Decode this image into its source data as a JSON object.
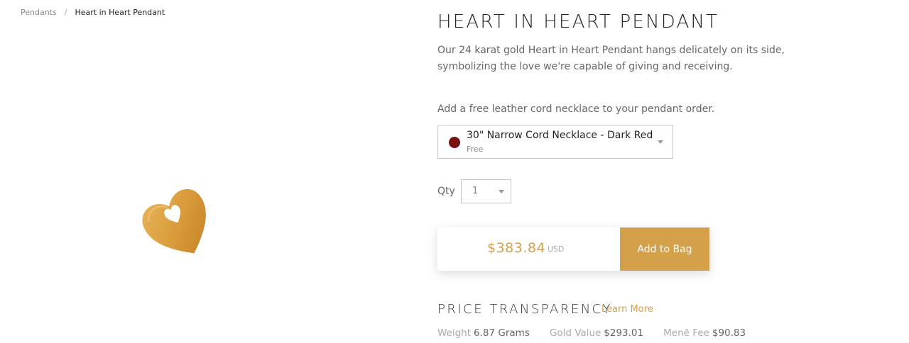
{
  "breadcrumb": {
    "parent": "Pendants",
    "separator": "/",
    "current": "Heart in Heart Pendant"
  },
  "product": {
    "title": "HEART IN HEART PENDANT",
    "description": "Our 24 karat gold Heart in Heart Pendant hangs delicately on its side, symbolizing the love we're capable of giving and receiving.",
    "image_icon": "gold-heart-pendant-icon"
  },
  "cord": {
    "prompt": "Add a free leather cord necklace to your pendant order.",
    "selected_label": "30\" Narrow Cord Necklace - Dark Red",
    "selected_sub": "Free",
    "swatch_color": "#7a1010"
  },
  "qty": {
    "label": "Qty",
    "value": "1"
  },
  "purchase": {
    "price": "$383.84",
    "currency": "USD",
    "button_label": "Add to Bag",
    "accent_color": "#d4a04a"
  },
  "transparency": {
    "title": "PRICE TRANSPARENCY",
    "learn_more": "Learn More",
    "metrics": [
      {
        "key": "Weight",
        "value": "6.87 Grams"
      },
      {
        "key": "Gold Value",
        "value": "$293.01"
      },
      {
        "key": "Menē Fee",
        "value": "$90.83"
      }
    ]
  }
}
